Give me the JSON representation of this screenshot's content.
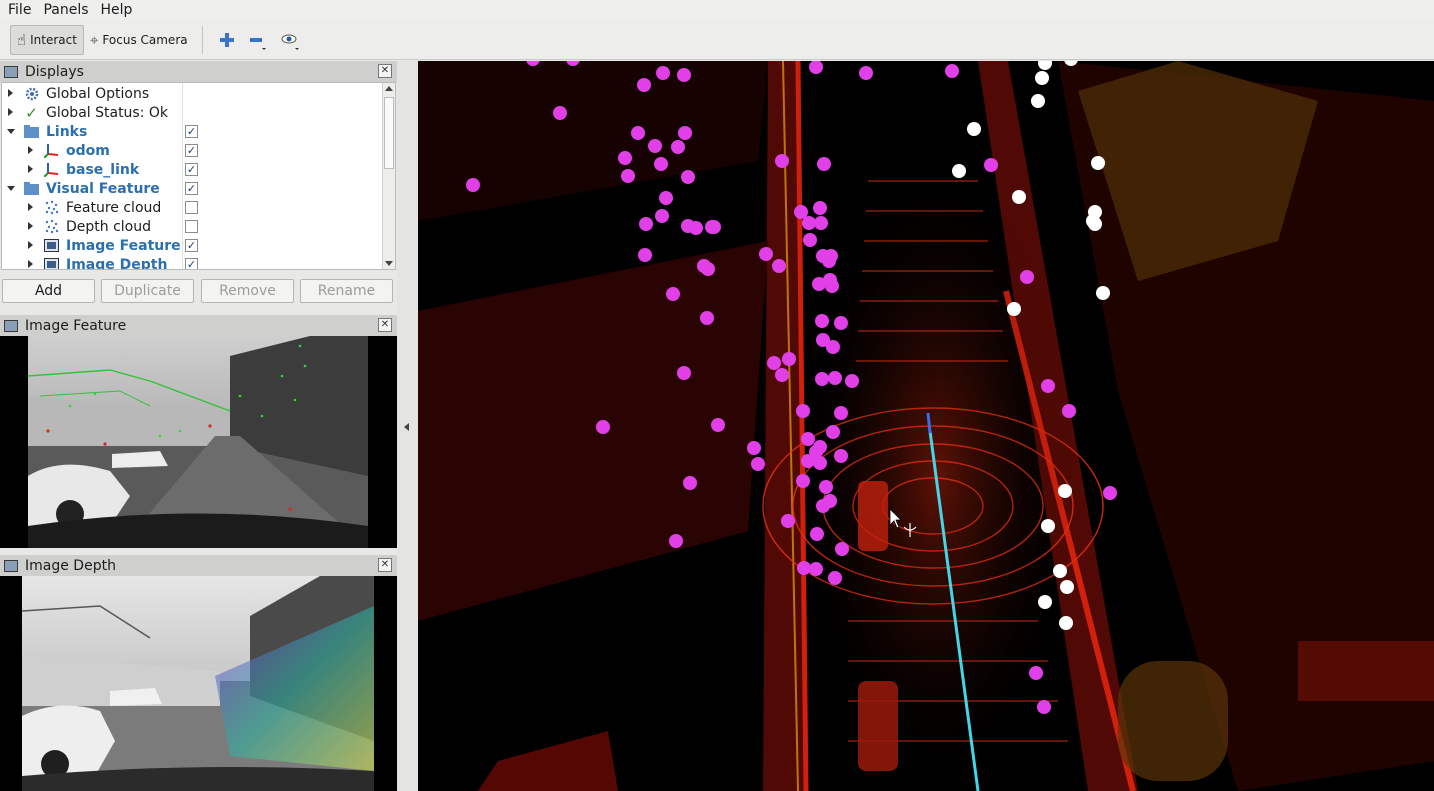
{
  "menu": {
    "file": "File",
    "panels": "Panels",
    "help": "Help"
  },
  "toolbar": {
    "interact": "Interact",
    "focus_camera": "Focus Camera"
  },
  "displays_panel": {
    "title": "Displays",
    "rows": [
      {
        "label": "Global Options",
        "expanded": false,
        "checked": null
      },
      {
        "label": "Global Status: Ok",
        "expanded": false,
        "checked": null
      },
      {
        "label": "Links",
        "expanded": true,
        "checked": true
      },
      {
        "label": "odom",
        "expanded": false,
        "checked": true
      },
      {
        "label": "base_link",
        "expanded": false,
        "checked": true
      },
      {
        "label": "Visual Feature",
        "expanded": true,
        "checked": true
      },
      {
        "label": "Feature cloud",
        "expanded": false,
        "checked": false
      },
      {
        "label": "Depth cloud",
        "expanded": false,
        "checked": false
      },
      {
        "label": "Image Feature",
        "expanded": false,
        "checked": true
      },
      {
        "label": "Image Depth",
        "expanded": false,
        "checked": true
      }
    ],
    "buttons": {
      "add": "Add",
      "duplicate": "Duplicate",
      "remove": "Remove",
      "rename": "Rename"
    }
  },
  "image_feature_panel": {
    "title": "Image Feature"
  },
  "image_depth_panel": {
    "title": "Image Depth"
  },
  "colors": {
    "accent_blue": "#2c6fb0",
    "feature_pink": "#e13fe8",
    "lidar_red": "#e01a0a",
    "path_cyan": "#43d6e8"
  }
}
